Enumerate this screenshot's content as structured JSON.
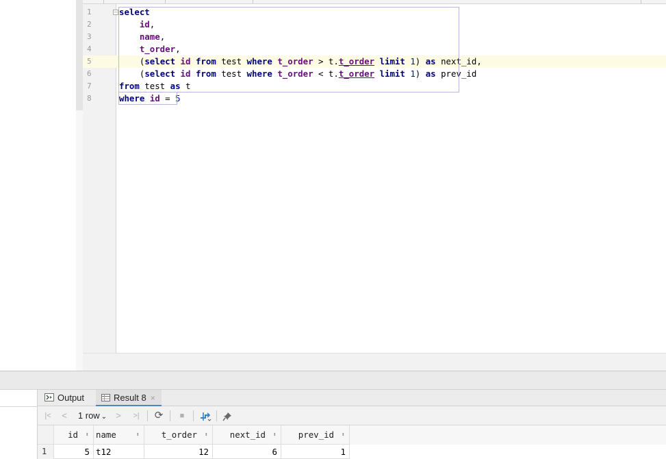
{
  "editor": {
    "line_numbers": [
      "1",
      "2",
      "3",
      "4",
      "5",
      "6",
      "7",
      "8"
    ],
    "current_line": 5,
    "lines": [
      [
        {
          "t": "select",
          "c": "kw"
        }
      ],
      [
        {
          "t": "    "
        },
        {
          "t": "id",
          "c": "col"
        },
        {
          "t": ","
        }
      ],
      [
        {
          "t": "    "
        },
        {
          "t": "name",
          "c": "col"
        },
        {
          "t": ","
        }
      ],
      [
        {
          "t": "    "
        },
        {
          "t": "t_order",
          "c": "col"
        },
        {
          "t": ","
        }
      ],
      [
        {
          "t": "    ("
        },
        {
          "t": "select",
          "c": "kw"
        },
        {
          "t": " "
        },
        {
          "t": "id",
          "c": "col"
        },
        {
          "t": " "
        },
        {
          "t": "from",
          "c": "kw"
        },
        {
          "t": " test "
        },
        {
          "t": "where",
          "c": "kw"
        },
        {
          "t": " "
        },
        {
          "t": "t_order",
          "c": "col"
        },
        {
          "t": " > t."
        },
        {
          "t": "t_order",
          "c": "col ul"
        },
        {
          "t": " "
        },
        {
          "t": "limit",
          "c": "kw"
        },
        {
          "t": " "
        },
        {
          "t": "1",
          "c": "num"
        },
        {
          "t": ") "
        },
        {
          "t": "as",
          "c": "kw"
        },
        {
          "t": " next_id,"
        }
      ],
      [
        {
          "t": "    ("
        },
        {
          "t": "select",
          "c": "kw"
        },
        {
          "t": " "
        },
        {
          "t": "id",
          "c": "col"
        },
        {
          "t": " "
        },
        {
          "t": "from",
          "c": "kw"
        },
        {
          "t": " test "
        },
        {
          "t": "where",
          "c": "kw"
        },
        {
          "t": " "
        },
        {
          "t": "t_order",
          "c": "col"
        },
        {
          "t": " < t."
        },
        {
          "t": "t_order",
          "c": "col ul"
        },
        {
          "t": " "
        },
        {
          "t": "limit",
          "c": "kw"
        },
        {
          "t": " "
        },
        {
          "t": "1",
          "c": "num"
        },
        {
          "t": ") "
        },
        {
          "t": "as",
          "c": "kw"
        },
        {
          "t": " prev_id"
        }
      ],
      [
        {
          "t": "from",
          "c": "kw"
        },
        {
          "t": " test "
        },
        {
          "t": "as",
          "c": "kw"
        },
        {
          "t": " t"
        }
      ],
      [
        {
          "t": "where",
          "c": "kw"
        },
        {
          "t": " "
        },
        {
          "t": "id",
          "c": "col"
        },
        {
          "t": " = "
        },
        {
          "t": "5",
          "c": "num"
        }
      ]
    ]
  },
  "services": {
    "tabs": {
      "output_label": "Output",
      "result_label": "Result 8",
      "close_glyph": "×"
    },
    "toolbar": {
      "first_glyph": "|<",
      "prev_glyph": "<",
      "rows_label": "1 row",
      "rows_dropdown_glyph": "⌄",
      "next_glyph": ">",
      "last_glyph": ">|",
      "refresh_glyph": "⟳",
      "stop_glyph": "■",
      "pin_glyph": "📌"
    },
    "grid": {
      "columns": [
        "id",
        "name",
        "t_order",
        "next_id",
        "prev_id"
      ],
      "sort_glyph": "⬍",
      "rows": [
        {
          "num": "1",
          "id": "5",
          "name": "t12",
          "t_order": "12",
          "next_id": "6",
          "prev_id": "1"
        }
      ]
    }
  },
  "colors": {
    "keyword": "#000080",
    "column": "#660e7a",
    "number": "#0000ff",
    "current_line": "#fdfbe3",
    "active_tab_underline": "#4a86c8"
  }
}
